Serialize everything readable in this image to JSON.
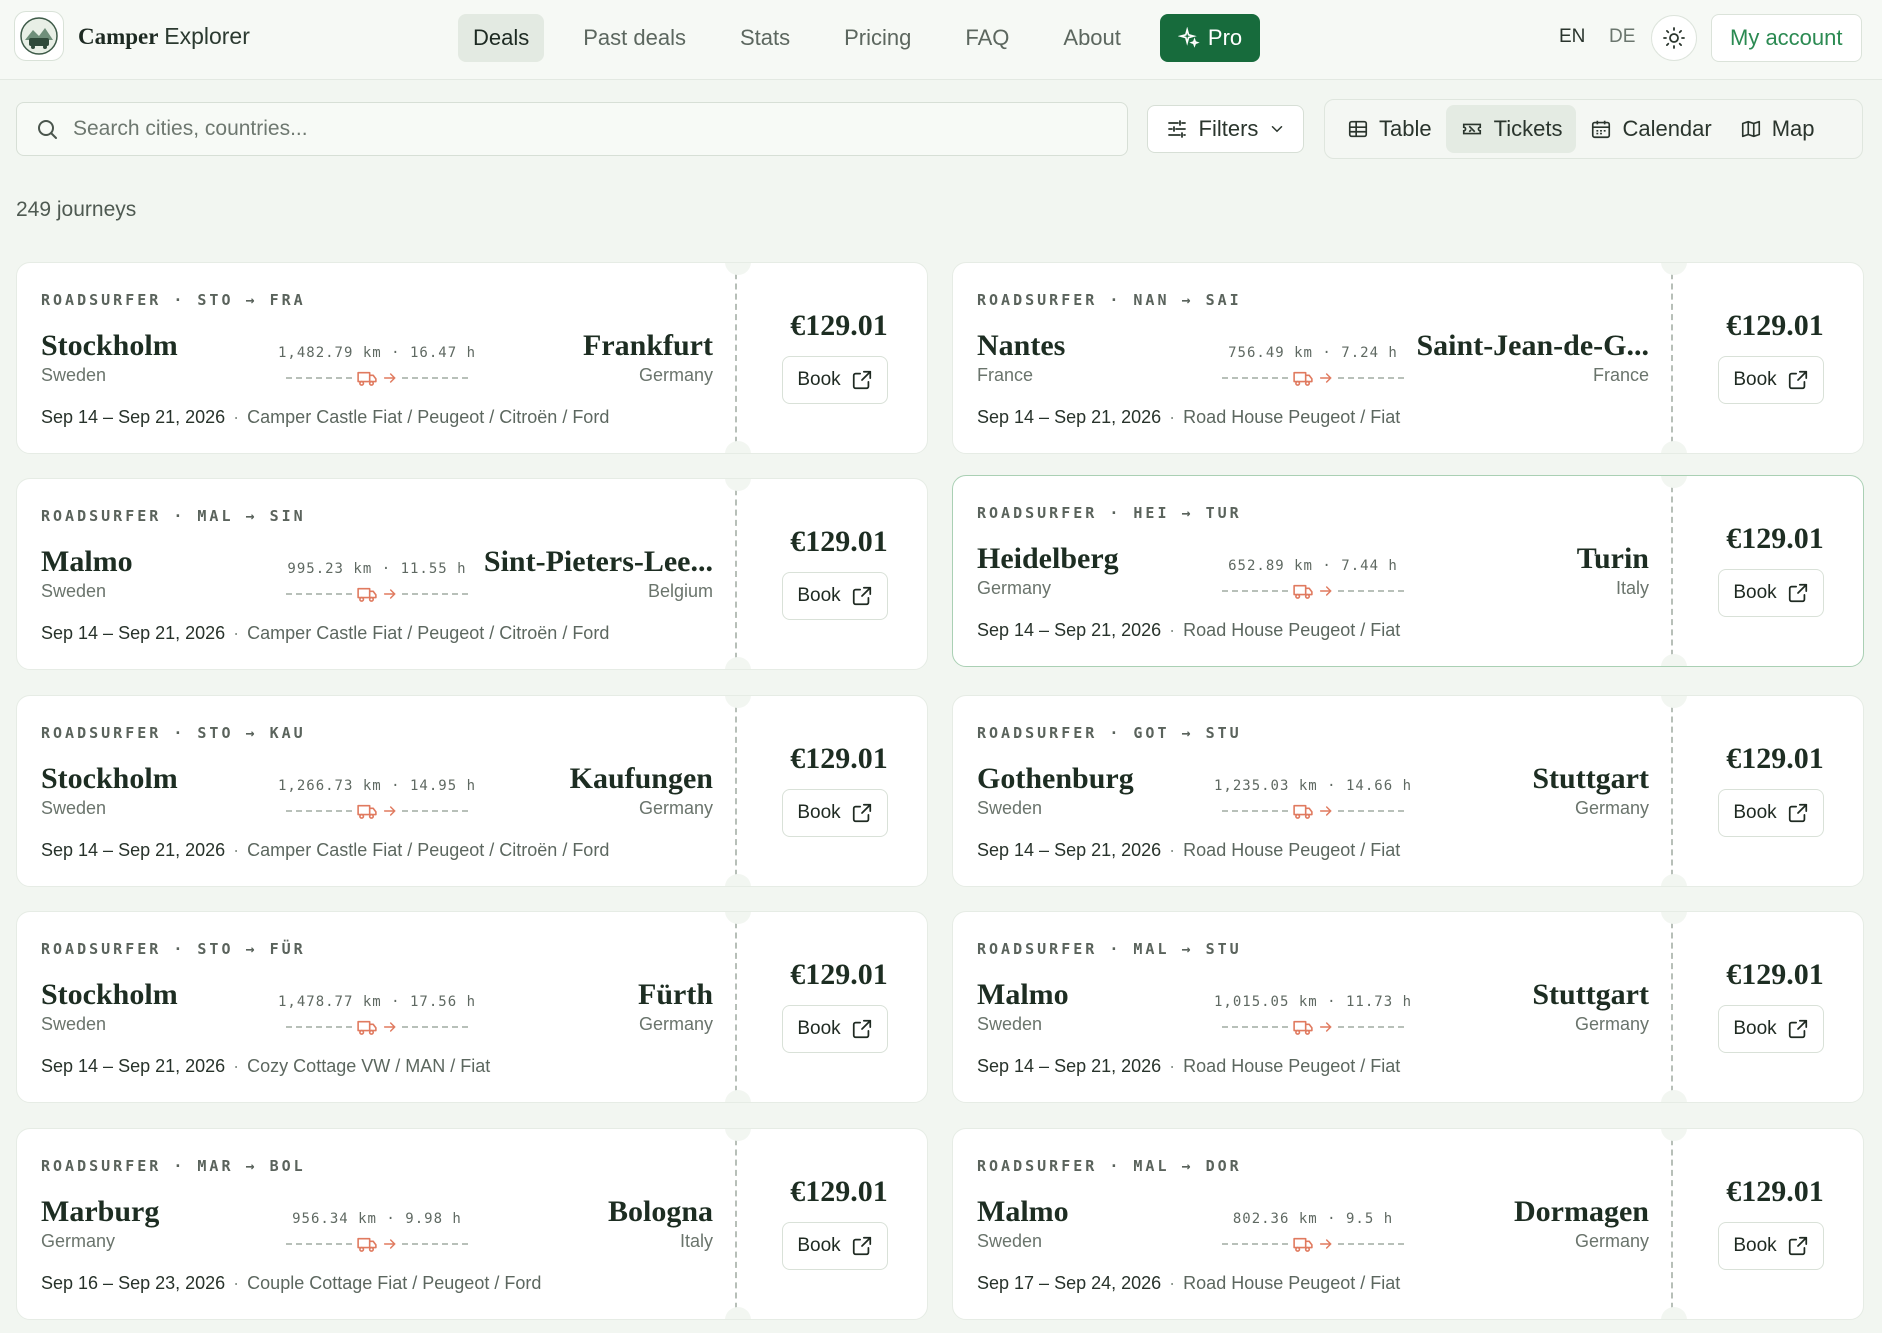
{
  "app": {
    "brand_bold": "Camper",
    "brand_rest": "Explorer"
  },
  "nav": {
    "items": [
      {
        "label": "Deals",
        "active": true
      },
      {
        "label": "Past deals"
      },
      {
        "label": "Stats"
      },
      {
        "label": "Pricing"
      },
      {
        "label": "FAQ"
      },
      {
        "label": "About"
      }
    ],
    "pro_label": "Pro",
    "lang_en": "EN",
    "lang_de": "DE",
    "account_label": "My account"
  },
  "toolbar": {
    "search_placeholder": "Search cities, countries...",
    "filters_label": "Filters",
    "views": [
      {
        "label": "Table",
        "icon": "table-icon"
      },
      {
        "label": "Tickets",
        "icon": "ticket-icon",
        "active": true
      },
      {
        "label": "Calendar",
        "icon": "calendar-icon"
      },
      {
        "label": "Map",
        "icon": "map-icon"
      }
    ]
  },
  "results": {
    "count_label": "249 journeys"
  },
  "colors": {
    "accent": "#176b3c",
    "accent_text": "#2b8a52",
    "route_icon": "#e07a5f"
  },
  "cards": [
    {
      "operator": "ROADSURFER",
      "from_code": "STO",
      "to_code": "FRA",
      "from_city": "Stockholm",
      "from_country": "Sweden",
      "to_city": "Frankfurt",
      "to_country": "Germany",
      "distance": "1,482.79 km",
      "duration": "16.47 h",
      "dates": "Sep 14 – Sep 21, 2026",
      "vehicle": "Camper Castle Fiat / Peugeot / Citroën / Ford",
      "price": "€129.01",
      "book_label": "Book"
    },
    {
      "operator": "ROADSURFER",
      "from_code": "NAN",
      "to_code": "SAI",
      "from_city": "Nantes",
      "from_country": "France",
      "to_city": "Saint-Jean-de-G...",
      "to_country": "France",
      "distance": "756.49 km",
      "duration": "7.24 h",
      "dates": "Sep 14 – Sep 21, 2026",
      "vehicle": "Road House Peugeot / Fiat",
      "price": "€129.01",
      "book_label": "Book"
    },
    {
      "operator": "ROADSURFER",
      "from_code": "MAL",
      "to_code": "SIN",
      "from_city": "Malmo",
      "from_country": "Sweden",
      "to_city": "Sint-Pieters-Lee...",
      "to_country": "Belgium",
      "distance": "995.23 km",
      "duration": "11.55 h",
      "dates": "Sep 14 – Sep 21, 2026",
      "vehicle": "Camper Castle Fiat / Peugeot / Citroën / Ford",
      "price": "€129.01",
      "book_label": "Book"
    },
    {
      "operator": "ROADSURFER",
      "from_code": "HEI",
      "to_code": "TUR",
      "from_city": "Heidelberg",
      "from_country": "Germany",
      "to_city": "Turin",
      "to_country": "Italy",
      "distance": "652.89 km",
      "duration": "7.44 h",
      "dates": "Sep 14 – Sep 21, 2026",
      "vehicle": "Road House Peugeot / Fiat",
      "price": "€129.01",
      "book_label": "Book",
      "highlight": true
    },
    {
      "operator": "ROADSURFER",
      "from_code": "STO",
      "to_code": "KAU",
      "from_city": "Stockholm",
      "from_country": "Sweden",
      "to_city": "Kaufungen",
      "to_country": "Germany",
      "distance": "1,266.73 km",
      "duration": "14.95 h",
      "dates": "Sep 14 – Sep 21, 2026",
      "vehicle": "Camper Castle Fiat / Peugeot / Citroën / Ford",
      "price": "€129.01",
      "book_label": "Book"
    },
    {
      "operator": "ROADSURFER",
      "from_code": "GOT",
      "to_code": "STU",
      "from_city": "Gothenburg",
      "from_country": "Sweden",
      "to_city": "Stuttgart",
      "to_country": "Germany",
      "distance": "1,235.03 km",
      "duration": "14.66 h",
      "dates": "Sep 14 – Sep 21, 2026",
      "vehicle": "Road House Peugeot / Fiat",
      "price": "€129.01",
      "book_label": "Book"
    },
    {
      "operator": "ROADSURFER",
      "from_code": "STO",
      "to_code": "FÜR",
      "from_city": "Stockholm",
      "from_country": "Sweden",
      "to_city": "Fürth",
      "to_country": "Germany",
      "distance": "1,478.77 km",
      "duration": "17.56 h",
      "dates": "Sep 14 – Sep 21, 2026",
      "vehicle": "Cozy Cottage VW / MAN / Fiat",
      "price": "€129.01",
      "book_label": "Book"
    },
    {
      "operator": "ROADSURFER",
      "from_code": "MAL",
      "to_code": "STU",
      "from_city": "Malmo",
      "from_country": "Sweden",
      "to_city": "Stuttgart",
      "to_country": "Germany",
      "distance": "1,015.05 km",
      "duration": "11.73 h",
      "dates": "Sep 14 – Sep 21, 2026",
      "vehicle": "Road House Peugeot / Fiat",
      "price": "€129.01",
      "book_label": "Book"
    },
    {
      "operator": "ROADSURFER",
      "from_code": "MAR",
      "to_code": "BOL",
      "from_city": "Marburg",
      "from_country": "Germany",
      "to_city": "Bologna",
      "to_country": "Italy",
      "distance": "956.34 km",
      "duration": "9.98 h",
      "dates": "Sep 16 – Sep 23, 2026",
      "vehicle": "Couple Cottage Fiat / Peugeot / Ford",
      "price": "€129.01",
      "book_label": "Book"
    },
    {
      "operator": "ROADSURFER",
      "from_code": "MAL",
      "to_code": "DOR",
      "from_city": "Malmo",
      "from_country": "Sweden",
      "to_city": "Dormagen",
      "to_country": "Germany",
      "distance": "802.36 km",
      "duration": "9.5 h",
      "dates": "Sep 17 – Sep 24, 2026",
      "vehicle": "Road House Peugeot / Fiat",
      "price": "€129.01",
      "book_label": "Book"
    }
  ]
}
